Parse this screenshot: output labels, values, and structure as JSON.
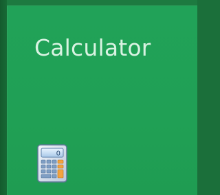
{
  "tile": {
    "title": "Calculator",
    "icon": "calculator-icon",
    "background_color": "#20a055",
    "text_color": "#d9f3e2"
  }
}
